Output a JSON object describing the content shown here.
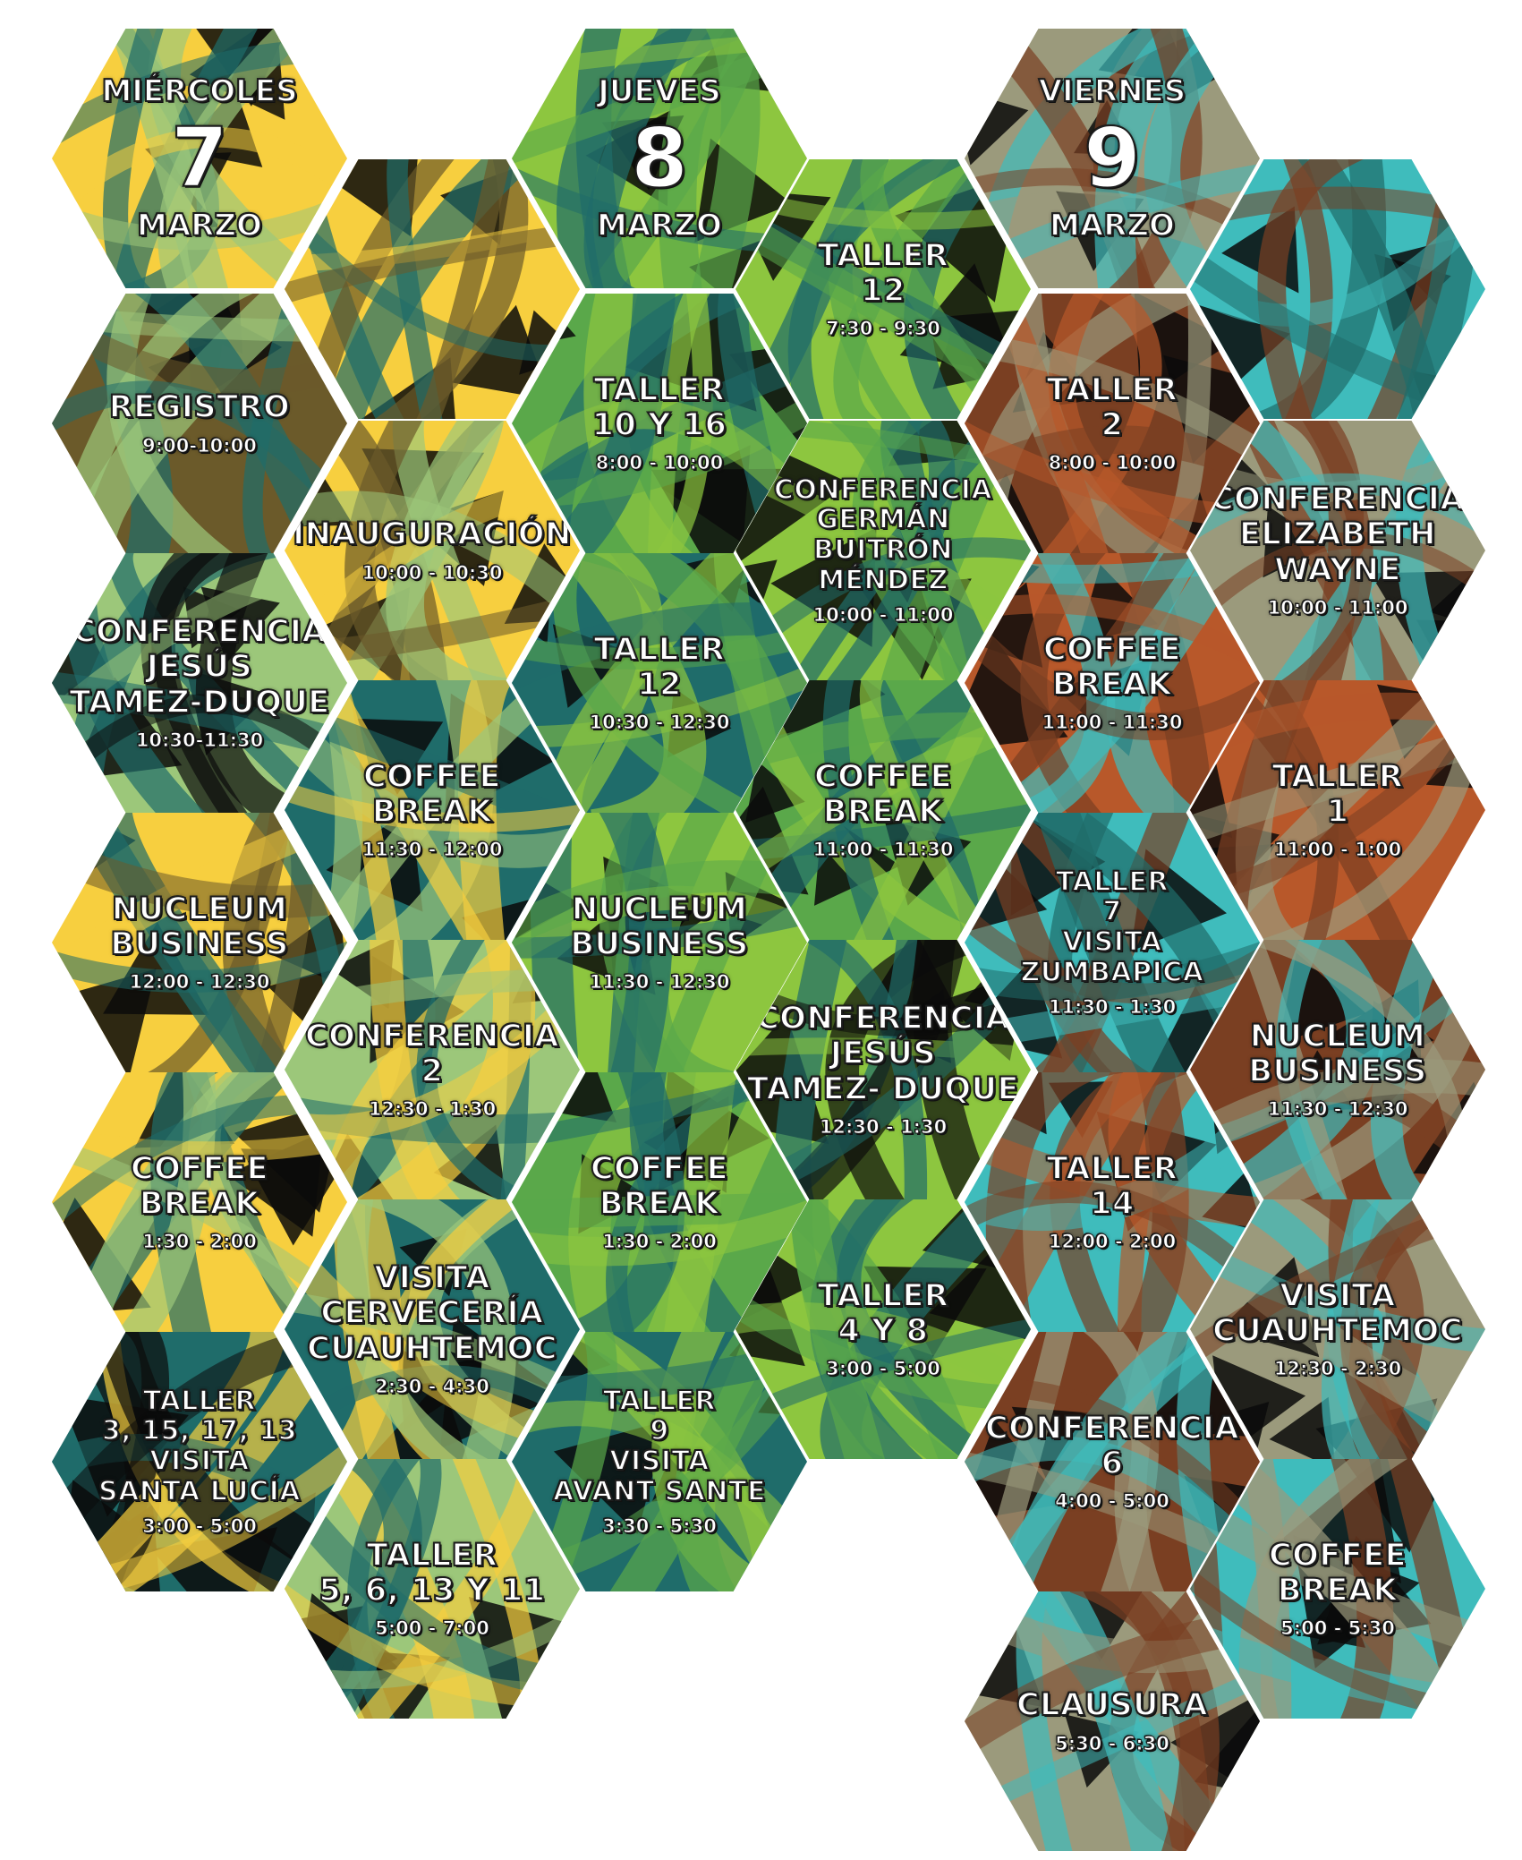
{
  "palette": {
    "yellow": "#f7cf3f",
    "lightGreen": "#9cc77a",
    "olive": "#6b5a2a",
    "teal": "#1f6c6a",
    "lime": "#8dc63f",
    "green": "#5aa84a",
    "brown": "#7a3f22",
    "rust": "#b8582a",
    "cyan": "#3fbcbc",
    "khaki": "#9b9a7c",
    "black": "#0b0b0b"
  },
  "days": [
    {
      "weekday": "MIÉRCOLES",
      "number": "7",
      "month": "MARZO"
    },
    {
      "weekday": "JUEVES",
      "number": "8",
      "month": "MARZO"
    },
    {
      "weekday": "VIERNES",
      "number": "9",
      "month": "MARZO"
    }
  ],
  "events": [
    {
      "lines": [
        "REGISTRO"
      ],
      "time": "9:00-10:00"
    },
    {
      "lines": [
        "INAUGURACIÓN"
      ],
      "time": "10:00 - 10:30"
    },
    {
      "lines": [
        "CONFERENCIA",
        "JESÚS",
        "TAMEZ-DUQUE"
      ],
      "time": "10:30-11:30"
    },
    {
      "lines": [
        "COFFEE",
        "BREAK"
      ],
      "time": "11:30 - 12:00"
    },
    {
      "lines": [
        "NUCLEUM",
        "BUSINESS"
      ],
      "time": "12:00 - 12:30"
    },
    {
      "lines": [
        "CONFERENCIA",
        "2"
      ],
      "time": "12:30 - 1:30"
    },
    {
      "lines": [
        "COFFEE",
        "BREAK"
      ],
      "time": "1:30 - 2:00"
    },
    {
      "lines": [
        "VISITA",
        "CERVECERÍA",
        "CUAUHTEMOC"
      ],
      "time": "2:30 - 4:30"
    },
    {
      "lines": [
        "TALLER",
        "3, 15, 17, 13",
        "VISITA",
        "SANTA LUCÍA"
      ],
      "time": "3:00 - 5:00"
    },
    {
      "lines": [
        "TALLER",
        "5, 6, 13 Y 11"
      ],
      "time": "5:00 - 7:00"
    },
    {
      "lines": [
        "TALLER",
        "12"
      ],
      "time": "7:30 - 9:30"
    },
    {
      "lines": [
        "TALLER",
        "10 Y 16"
      ],
      "time": "8:00 - 10:00"
    },
    {
      "lines": [
        "CONFERENCIA",
        "GERMÁN",
        "BUITRÓN",
        "MÉNDEZ"
      ],
      "time": "10:00 - 11:00"
    },
    {
      "lines": [
        "TALLER",
        "12"
      ],
      "time": "10:30 - 12:30"
    },
    {
      "lines": [
        "COFFEE",
        "BREAK"
      ],
      "time": "11:00 - 11:30"
    },
    {
      "lines": [
        "NUCLEUM",
        "BUSINESS"
      ],
      "time": "11:30 - 12:30"
    },
    {
      "lines": [
        "CONFERENCIA",
        "JESÚS",
        "TAMEZ- DUQUE"
      ],
      "time": "12:30 - 1:30"
    },
    {
      "lines": [
        "COFFEE",
        "BREAK"
      ],
      "time": "1:30 - 2:00"
    },
    {
      "lines": [
        "TALLER",
        "4 Y 8"
      ],
      "time": "3:00 - 5:00"
    },
    {
      "lines": [
        "TALLER",
        "9",
        "VISITA",
        "AVANT SANTE"
      ],
      "time": "3:30 - 5:30"
    },
    {
      "lines": [
        "TALLER",
        "2"
      ],
      "time": "8:00 - 10:00"
    },
    {
      "lines": [
        "CONFERENCIA",
        "ELIZABETH",
        "WAYNE"
      ],
      "time": "10:00 - 11:00"
    },
    {
      "lines": [
        "COFFEE",
        "BREAK"
      ],
      "time": "11:00 - 11:30"
    },
    {
      "lines": [
        "TALLER",
        "1"
      ],
      "time": "11:00 - 1:00"
    },
    {
      "lines": [
        "TALLER",
        "7",
        "VISITA",
        "ZUMBAPICA"
      ],
      "time": "11:30 - 1:30"
    },
    {
      "lines": [
        "NUCLEUM",
        "BUSINESS"
      ],
      "time": "11:30 - 12:30"
    },
    {
      "lines": [
        "TALLER",
        "14"
      ],
      "time": "12:00 - 2:00"
    },
    {
      "lines": [
        "VISITA",
        "CUAUHTEMOC"
      ],
      "time": "12:30 - 2:30"
    },
    {
      "lines": [
        "CONFERENCIA",
        "6"
      ],
      "time": "4:00 - 5:00"
    },
    {
      "lines": [
        "COFFEE",
        "BREAK"
      ],
      "time": "5:00 - 5:30"
    },
    {
      "lines": [
        "CLAUSURA"
      ],
      "time": "5:30 - 6:30"
    }
  ]
}
